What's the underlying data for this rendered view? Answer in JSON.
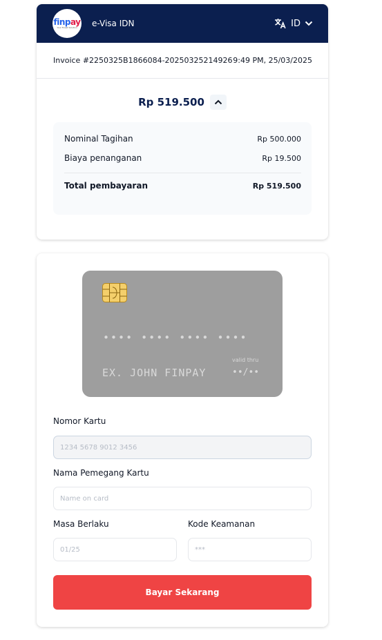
{
  "header": {
    "logo_text_a": "finp",
    "logo_text_b": "ay",
    "logo_tagline": "Your Finest Solution",
    "app_title": "e-Visa IDN",
    "language_icon": "translate-icon",
    "language_code": "ID",
    "chevron_icon": "chevron-down-icon"
  },
  "invoice": {
    "number": "Invoice #2250325B1866084-20250325214926",
    "datetime": "9:49 PM, 25/03/2025"
  },
  "summary": {
    "amount": "Rp 519.500",
    "toggle_icon": "chevron-up-icon",
    "rows": [
      {
        "label": "Nominal Tagihan",
        "value": "Rp 500.000"
      },
      {
        "label": "Biaya penanganan",
        "value": "Rp 19.500"
      }
    ],
    "total": {
      "label": "Total pembayaran",
      "value": "Rp 519.500"
    }
  },
  "card_preview": {
    "number": "•••• •••• •••• ••••",
    "holder": "EX. JOHN FINPAY",
    "valid_label": "valid thru",
    "valid": "••/••",
    "chip_icon": "card-chip-icon"
  },
  "form": {
    "card_number": {
      "label": "Nomor Kartu",
      "value": "",
      "placeholder": "1234 5678 9012 3456"
    },
    "holder_name": {
      "label": "Nama Pemegang Kartu",
      "value": "",
      "placeholder": "Name on card"
    },
    "expiry": {
      "label": "Masa Berlaku",
      "value": "",
      "placeholder": "01/25"
    },
    "cvv": {
      "label": "Kode Keamanan",
      "value": "",
      "placeholder": "***"
    },
    "submit_label": "Bayar Sekarang"
  },
  "colors": {
    "header_bg": "#0b1f4f",
    "pay_button": "#ef4444",
    "card_bg": "#9e9e9e"
  }
}
